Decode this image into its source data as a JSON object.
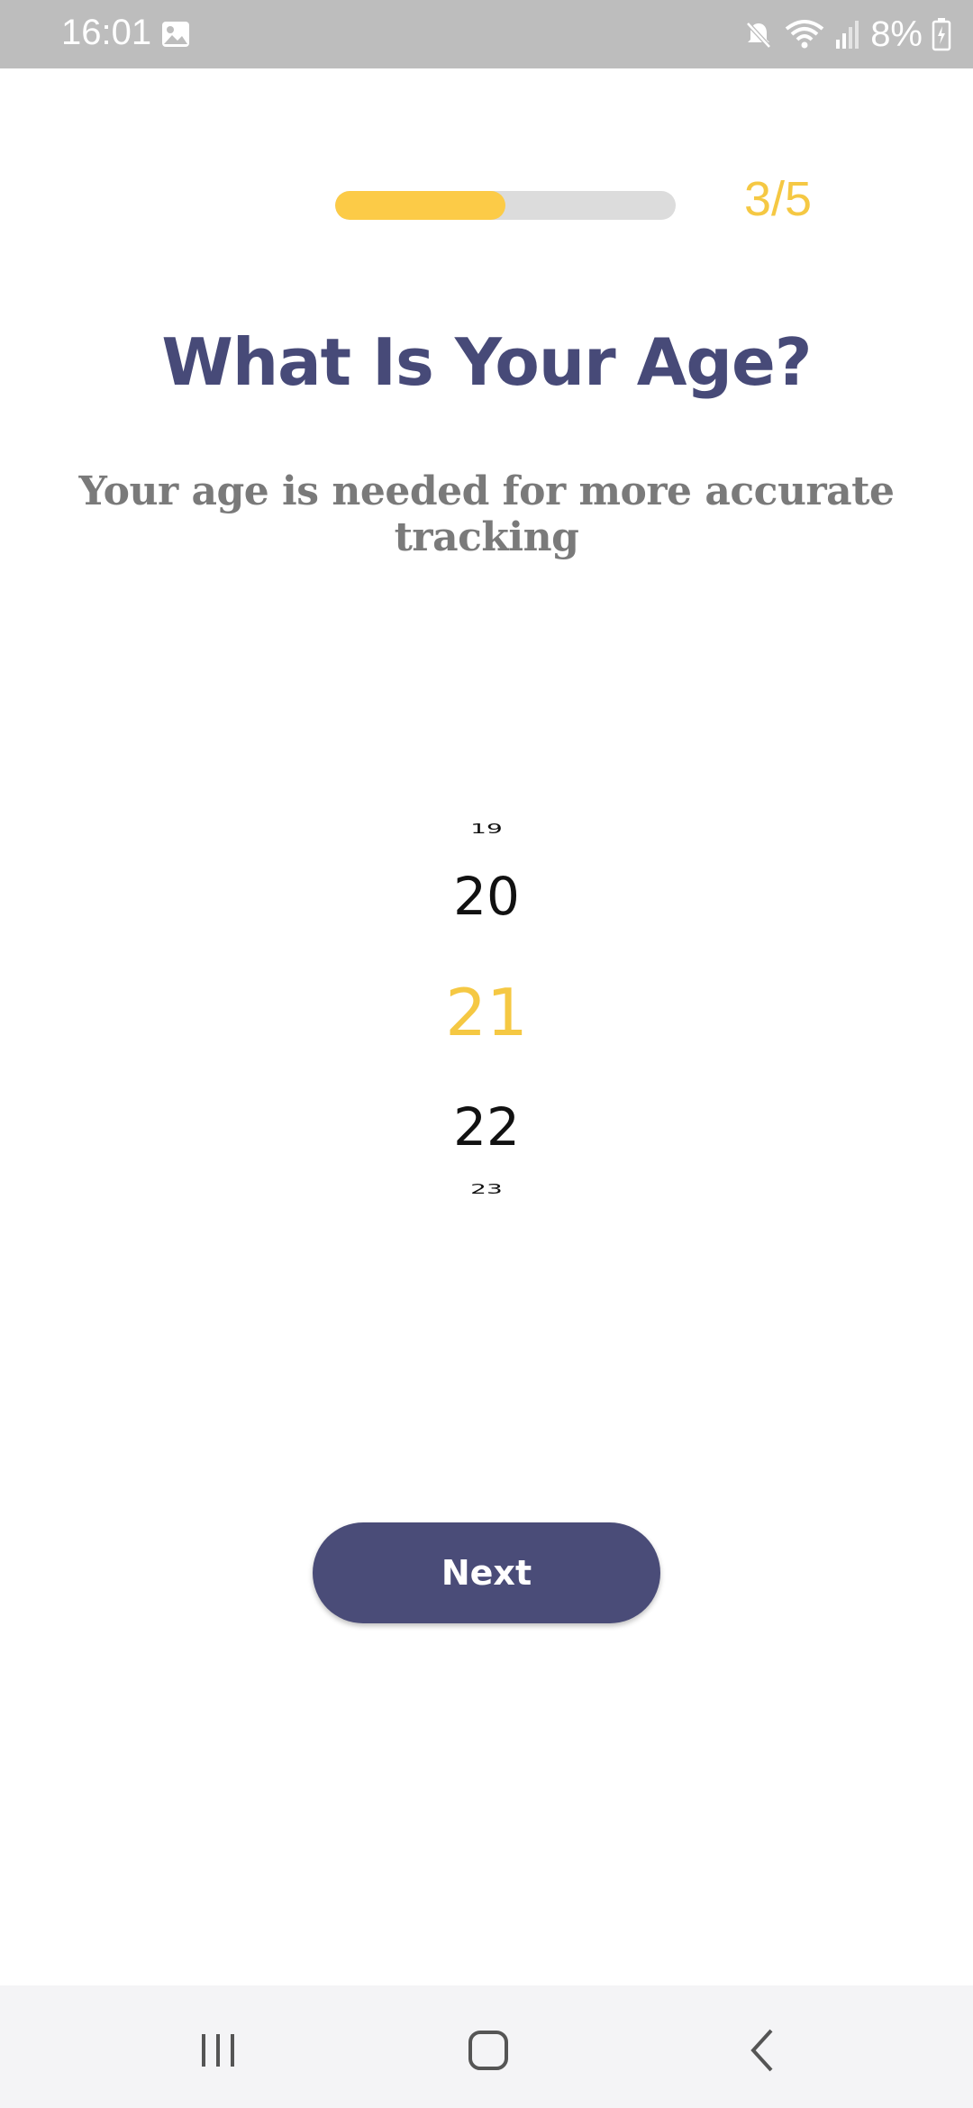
{
  "status_bar": {
    "time": "16:01",
    "battery": "8%",
    "icons": [
      "gallery-icon",
      "mute-icon",
      "wifi-icon",
      "signal-icon",
      "battery-icon"
    ]
  },
  "progress": {
    "fraction": 0.5,
    "step_label": "3/5",
    "fill_color": "#fccb47",
    "track_color": "#dcdcdc"
  },
  "title": "What Is Your Age?",
  "subtitle": "Your age is needed for more accurate tracking",
  "age_picker": {
    "items": [
      "19",
      "20",
      "21",
      "22",
      "23"
    ],
    "selected": "21",
    "selected_color": "#f5c843"
  },
  "next_button": {
    "label": "Next",
    "color": "#4a4c78"
  },
  "nav_bar": {
    "icons": [
      "recent-apps-icon",
      "home-icon",
      "back-icon"
    ]
  }
}
